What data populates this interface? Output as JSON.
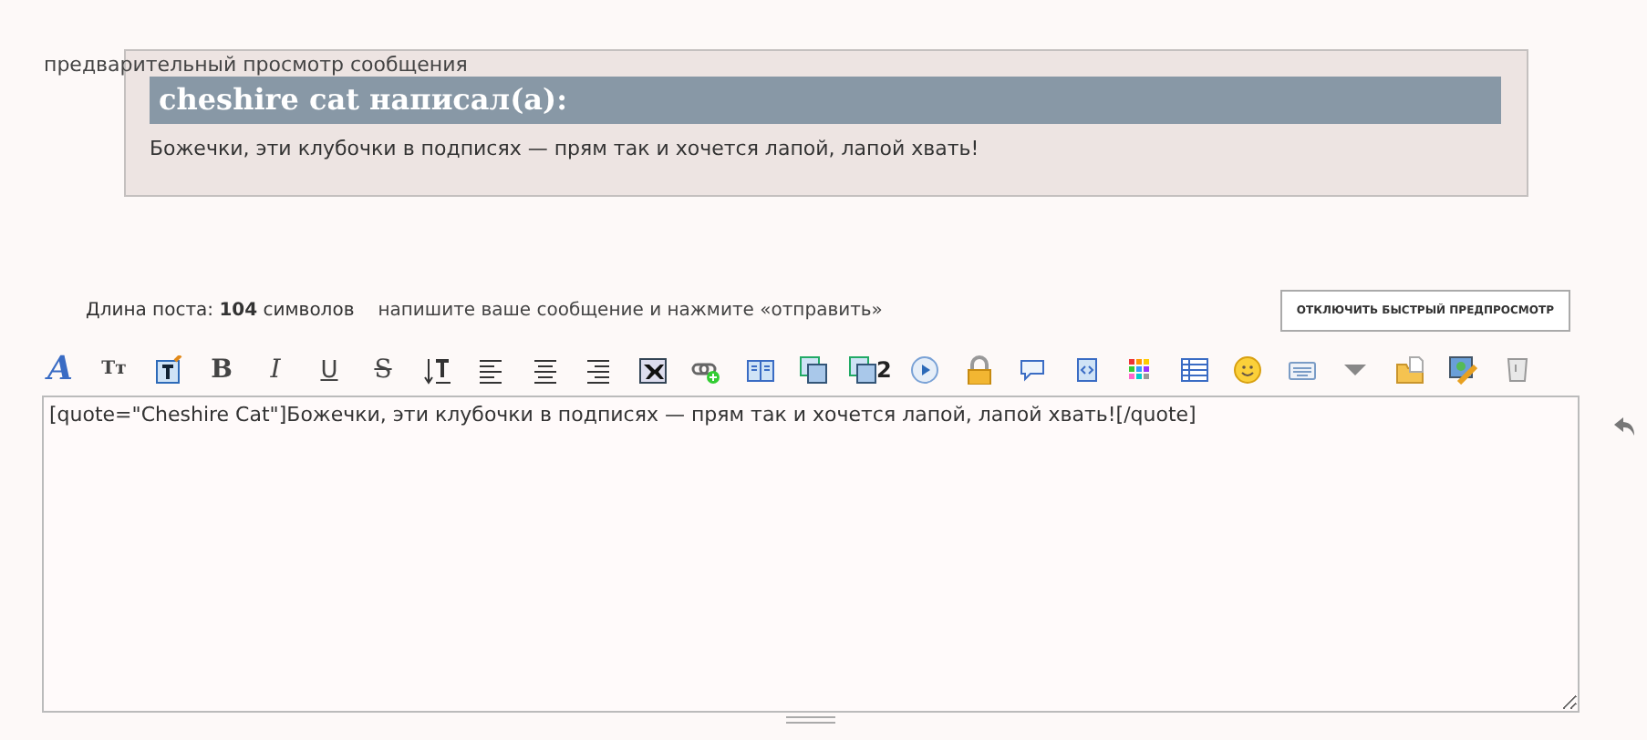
{
  "preview": {
    "label": "предварительный просмотр сообщения",
    "quote_header": "cheshire cat написал(а):",
    "quote_body": "Божечки, эти клубочки в подписях — прям так и хочется лапой, лапой хвать!"
  },
  "post_info": {
    "length_label": "Длина поста:",
    "length_value": "104",
    "length_unit": "символов",
    "hint": "напишите ваше сообщение и нажмите «отправить»"
  },
  "toggle_button": "отключить быстрый предпросмотр",
  "toolbar": [
    {
      "kind": "glyph",
      "label": "A"
    },
    {
      "kind": "glyph",
      "label": "Tт"
    },
    {
      "kind": "icon"
    },
    {
      "kind": "glyph",
      "label": "B"
    },
    {
      "kind": "glyph",
      "label": "I"
    },
    {
      "kind": "glyph",
      "label": "U"
    },
    {
      "kind": "glyph",
      "label": "S"
    },
    {
      "kind": "icon"
    },
    {
      "kind": "icon"
    },
    {
      "kind": "icon"
    },
    {
      "kind": "icon"
    },
    {
      "kind": "icon"
    },
    {
      "kind": "icon"
    },
    {
      "kind": "icon"
    },
    {
      "kind": "icon"
    },
    {
      "kind": "icon",
      "label": "2"
    },
    {
      "kind": "icon"
    },
    {
      "kind": "icon"
    },
    {
      "kind": "icon"
    },
    {
      "kind": "icon"
    },
    {
      "kind": "icon"
    },
    {
      "kind": "icon"
    },
    {
      "kind": "icon"
    },
    {
      "kind": "icon"
    },
    {
      "kind": "icon"
    },
    {
      "kind": "icon"
    },
    {
      "kind": "icon"
    },
    {
      "kind": "icon"
    }
  ],
  "message": {
    "value": "[quote=\"Cheshire Cat\"]Божечки, эти клубочки в подписях — прям так и хочется лапой, лапой хвать![/quote]"
  }
}
